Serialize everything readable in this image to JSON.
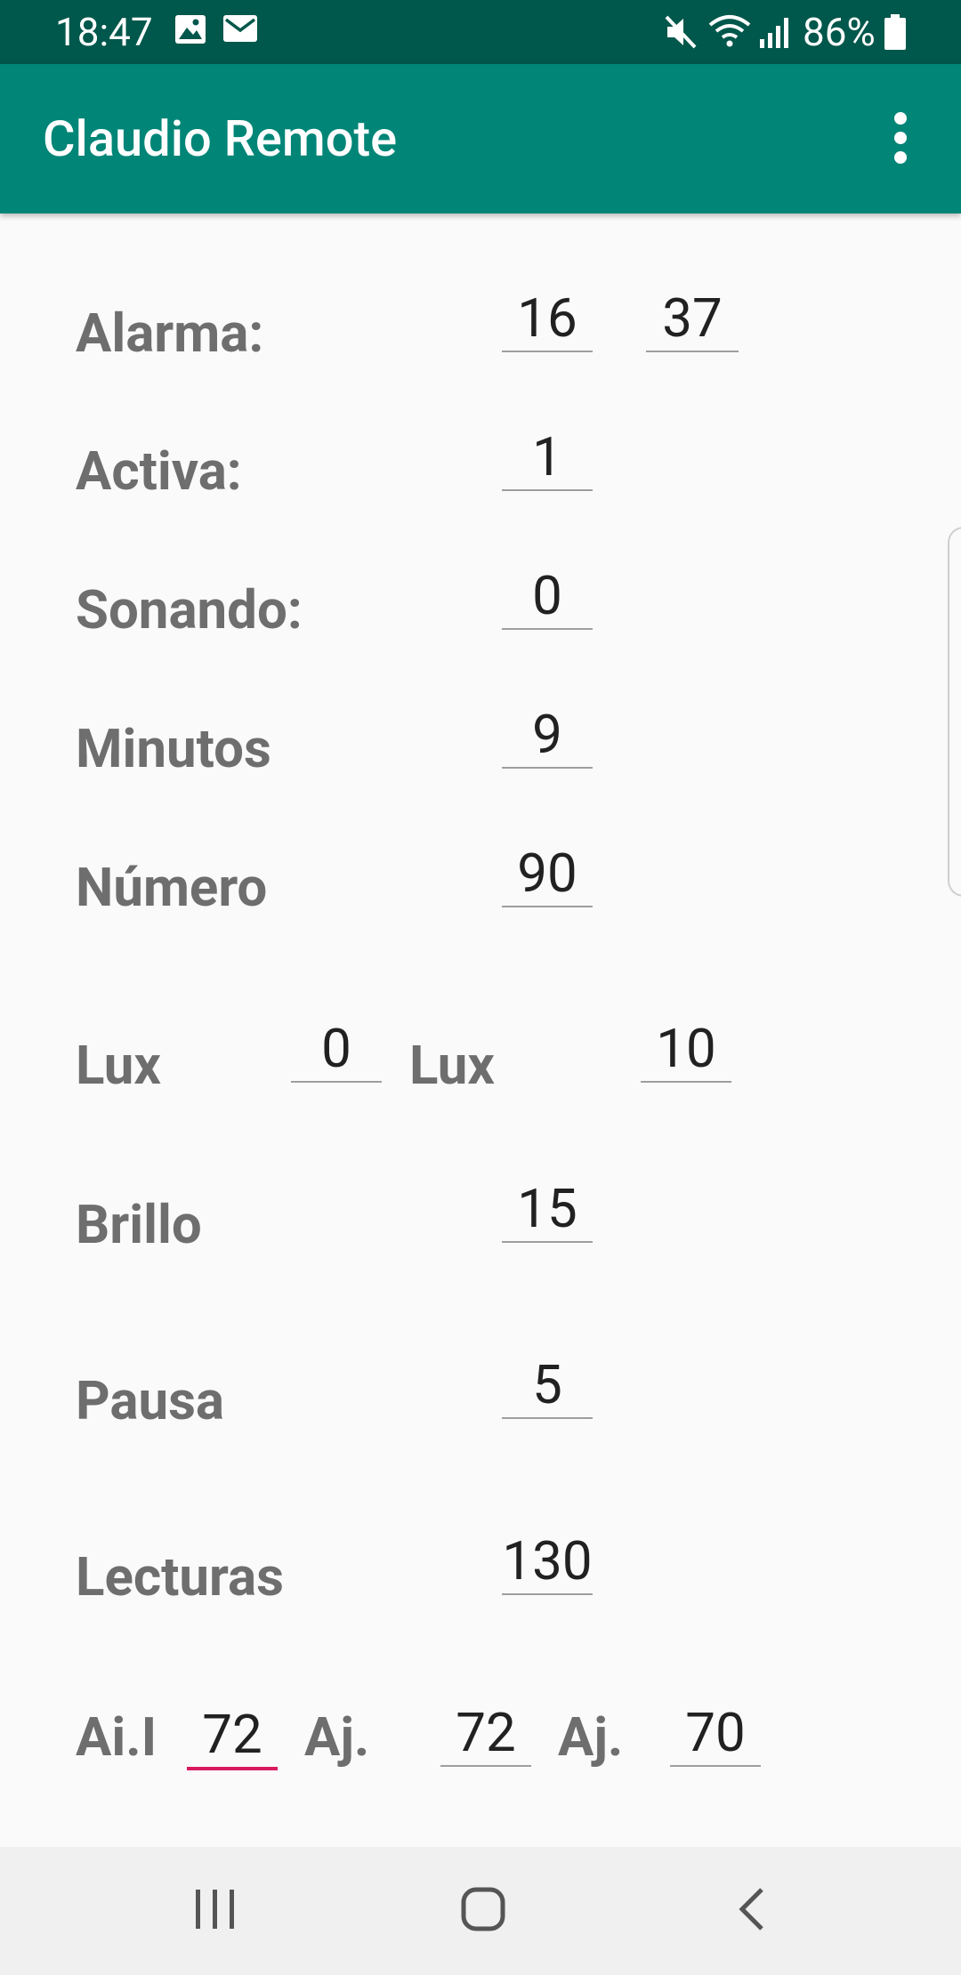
{
  "status_bar": {
    "time": "18:47",
    "battery": "86%",
    "icons": [
      "image-icon",
      "mail-icon",
      "mute-icon",
      "wifi-icon",
      "signal-icon",
      "battery-icon"
    ]
  },
  "app_bar": {
    "title": "Claudio Remote",
    "menu_icon": "more-vert-icon"
  },
  "form": {
    "alarma": {
      "label": "Alarma:",
      "hour": "16",
      "minute": "37"
    },
    "activa": {
      "label": "Activa:",
      "value": "1"
    },
    "sonando": {
      "label": "Sonando:",
      "value": "0"
    },
    "minutos": {
      "label": "Minutos",
      "value": "9"
    },
    "numero": {
      "label": "Número",
      "value": "90"
    },
    "lux": {
      "label1": "Lux",
      "value1": "0",
      "label2": "Lux",
      "value2": "10"
    },
    "brillo": {
      "label": "Brillo",
      "value": "15"
    },
    "pausa": {
      "label": "Pausa",
      "value": "5"
    },
    "lecturas": {
      "label": "Lecturas",
      "value": "130"
    },
    "ajustes": {
      "label1": "Ai.I",
      "value1": "72",
      "label2": "Aj.",
      "value2": "72",
      "label3": "Aj.",
      "value3": "70"
    }
  },
  "nav_bar": {
    "icons": [
      "recent-apps-icon",
      "home-icon",
      "back-icon"
    ]
  },
  "colors": {
    "status_bar": "#00574b",
    "app_bar": "#008577",
    "accent": "#d81b60",
    "label": "#6e6e6e"
  }
}
